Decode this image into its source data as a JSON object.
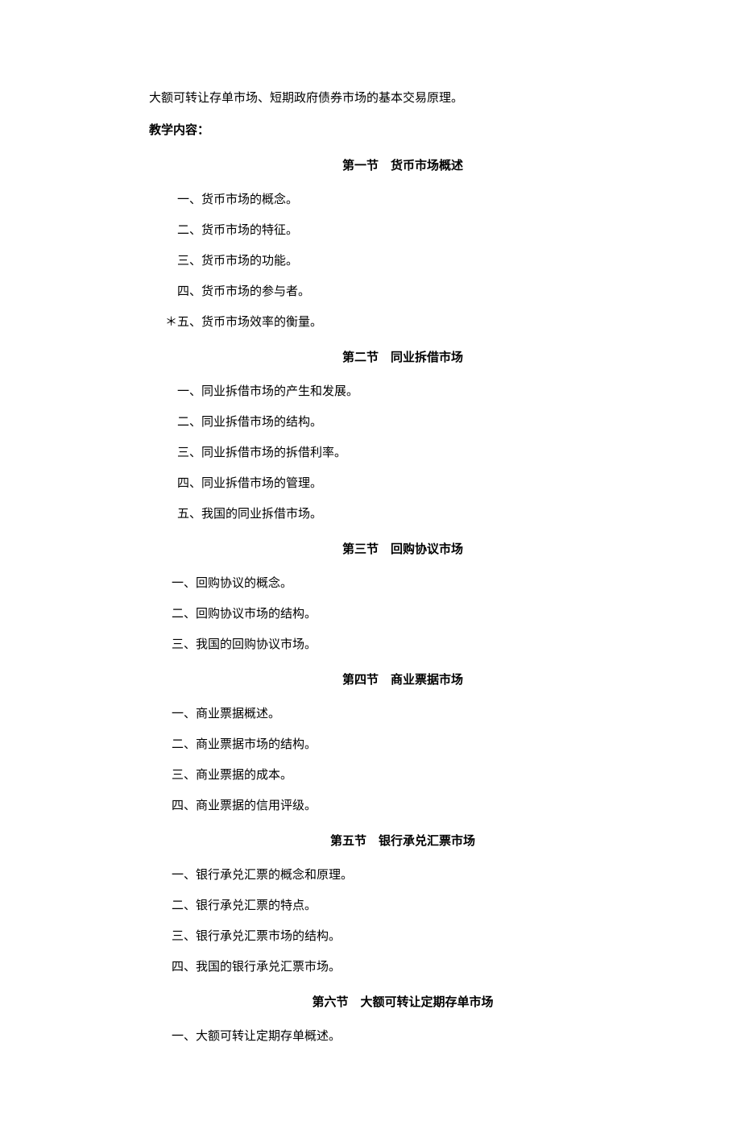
{
  "intro": "大额可转让存单市场、短期政府债券市场的基本交易原理。",
  "content_label": "教学内容：",
  "sections": [
    {
      "title": "第一节　货币市场概述",
      "items": [
        "一、货币市场的概念。",
        "二、货币市场的特征。",
        "三、货币市场的功能。",
        "四、货币市场的参与者。"
      ],
      "star_item": "＊五、货币市场效率的衡量。"
    },
    {
      "title": "第二节　同业拆借市场",
      "items": [
        "一、同业拆借市场的产生和发展。",
        "二、同业拆借市场的结构。",
        "三、同业拆借市场的拆借利率。",
        "四、同业拆借市场的管理。",
        "五、我国的同业拆借市场。"
      ]
    },
    {
      "title": "第三节　回购协议市场",
      "items": [
        "一、回购协议的概念。",
        "二、回购协议市场的结构。",
        "三、我国的回购协议市场。"
      ]
    },
    {
      "title": "第四节　商业票据市场",
      "items": [
        "一、商业票据概述。",
        "二、商业票据市场的结构。",
        "三、商业票据的成本。",
        "四、商业票据的信用评级。"
      ]
    },
    {
      "title": "第五节　银行承兑汇票市场",
      "items": [
        "一、银行承兑汇票的概念和原理。",
        "二、银行承兑汇票的特点。",
        "三、银行承兑汇票市场的结构。",
        "四、我国的银行承兑汇票市场。"
      ]
    },
    {
      "title": "第六节　大额可转让定期存单市场",
      "items": [
        "一、大额可转让定期存单概述。"
      ]
    }
  ]
}
